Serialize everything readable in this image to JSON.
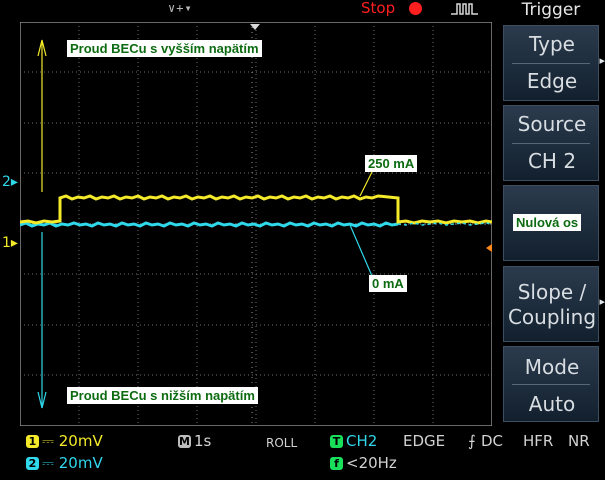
{
  "status": {
    "timebase_arrows": "∨+▾",
    "run_state": "Stop"
  },
  "trigger_menu": {
    "title": "Trigger",
    "type": {
      "label": "Type",
      "value": "Edge"
    },
    "source": {
      "label": "Source",
      "value": "CH 2"
    },
    "slope_coupling": {
      "label_line1": "Slope /",
      "label_line2": "Coupling"
    },
    "mode": {
      "label": "Mode",
      "value": "Auto"
    }
  },
  "channels": {
    "ch1": {
      "number": "1",
      "coupling": "⎓",
      "scale": "20mV",
      "marker": "1",
      "color": "#f4ea2a"
    },
    "ch2": {
      "number": "2",
      "coupling": "⎓",
      "scale": "20mV",
      "marker": "2",
      "color": "#2fd8ea"
    }
  },
  "horizontal": {
    "icon": "M",
    "scale": "1s",
    "mode": "ROLL"
  },
  "trigger_status": {
    "source_icon": "T",
    "source": "CH2",
    "type": "EDGE",
    "slope": "⨍",
    "coupling": "DC",
    "filter1": "HFR",
    "filter2": "NR",
    "freq_icon": "f",
    "frequency": "<20Hz"
  },
  "annotations": {
    "top_label": "Proud BECu s vyšším napätím",
    "bottom_label": "Proud BECu s nižším napätím",
    "high_current": "250 mA",
    "zero_current": "0 mA",
    "zero_axis": "Nulová os"
  },
  "colors": {
    "ch1": "#f4ea2a",
    "ch2": "#2fd8ea",
    "trigger": "#19e05a",
    "stop": "#ff1f1f",
    "grid": "#7a7a7a",
    "annotation_text": "#0d6b12"
  }
}
